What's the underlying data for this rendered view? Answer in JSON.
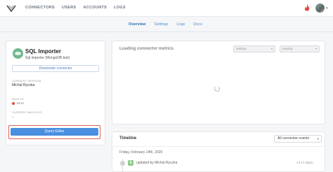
{
  "nav": {
    "items": [
      "CONNECTORS",
      "USERS",
      "ACCOUNTS",
      "LOGS"
    ]
  },
  "subnav": {
    "tabs": [
      {
        "label": "Overview",
        "active": true
      },
      {
        "label": "Settings",
        "active": false
      },
      {
        "label": "Logs",
        "active": false
      },
      {
        "label": "Docs",
        "active": false
      }
    ]
  },
  "connector": {
    "title": "SQL Importer",
    "subtitle": "Sql importer (MongoDB test)",
    "deactivate_label": "Deactivate connector",
    "version_label": "CURRENT VERSION",
    "version_value": "Michal Ryczka",
    "health_label": "HEALTH",
    "health_value": "Error",
    "backlog_label": "CURRENT BACKLOG",
    "backlog_value": "--",
    "query_editor_label": "Query Editor"
  },
  "metrics": {
    "title": "Loading connector metrics",
    "select1": "loading",
    "select2": "loading"
  },
  "timeline": {
    "title": "Timeline",
    "filter": "All connector events",
    "date": "Friday, February 14th, 2020",
    "event_badge": "S",
    "event_text": "updated by Michal Ryczka",
    "event_time": "14:17:45pm"
  },
  "colors": {
    "accent": "#4a8fe0",
    "error": "#e04a3f",
    "highlight": "#e0604a"
  }
}
